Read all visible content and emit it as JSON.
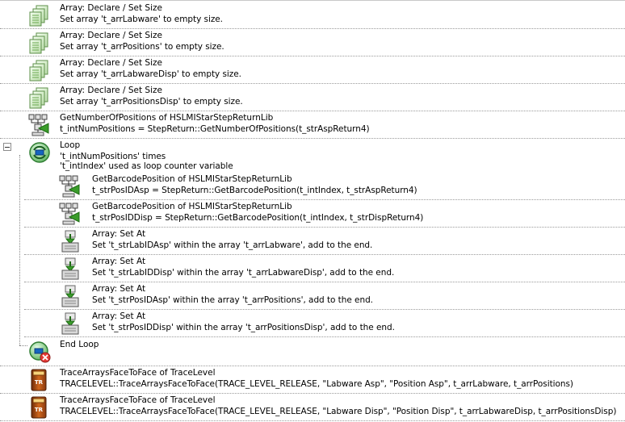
{
  "steps": [
    {
      "title": "Array: Declare / Set Size",
      "detail": "Set array 't_arrLabware' to empty size.",
      "icon": "array-declare-icon"
    },
    {
      "title": "Array: Declare / Set Size",
      "detail": "Set array 't_arrPositions' to empty size.",
      "icon": "array-declare-icon"
    },
    {
      "title": "Array: Declare / Set Size",
      "detail": "Set array 't_arrLabwareDisp' to empty size.",
      "icon": "array-declare-icon"
    },
    {
      "title": "Array: Declare / Set Size",
      "detail": "Set array 't_arrPositionsDisp' to empty size.",
      "icon": "array-declare-icon"
    },
    {
      "title": "GetNumberOfPositions of HSLMIStarStepReturnLib",
      "detail": "t_intNumPositions = StepReturn::GetNumberOfPositions(t_strAspReturn4)",
      "icon": "library-function-icon"
    },
    {
      "title": "Loop",
      "detail": "'t_intNumPositions' times",
      "detail2": "'t_intIndex' used as loop counter variable",
      "icon": "loop-icon"
    },
    {
      "title": "GetBarcodePosition of HSLMIStarStepReturnLib",
      "detail": "t_strPosIDAsp = StepReturn::GetBarcodePosition(t_intIndex, t_strAspReturn4)",
      "icon": "library-function-icon"
    },
    {
      "title": "GetBarcodePosition of HSLMIStarStepReturnLib",
      "detail": "t_strPosIDDisp = StepReturn::GetBarcodePosition(t_intIndex, t_strDispReturn4)",
      "icon": "library-function-icon"
    },
    {
      "title": "Array: Set At",
      "detail": "Set 't_strLabIDAsp' within the array 't_arrLabware', add to the end.",
      "icon": "array-set-icon"
    },
    {
      "title": "Array: Set At",
      "detail": "Set 't_strLabIDDisp' within the array 't_arrLabwareDisp', add to the end.",
      "icon": "array-set-icon"
    },
    {
      "title": "Array: Set At",
      "detail": "Set 't_strPosIDAsp' within the array 't_arrPositions', add to the end.",
      "icon": "array-set-icon"
    },
    {
      "title": "Array: Set At",
      "detail": "Set 't_strPosIDDisp' within the array 't_arrPositionsDisp', add to the end.",
      "icon": "array-set-icon"
    },
    {
      "title": "End Loop",
      "icon": "end-loop-icon"
    },
    {
      "title": "TraceArraysFaceToFace of TraceLevel",
      "detail": "TRACELEVEL::TraceArraysFaceToFace(TRACE_LEVEL_RELEASE, \"Labware Asp\", \"Position Asp\", t_arrLabware, t_arrPositions)",
      "icon": "trace-book-icon"
    },
    {
      "title": "TraceArraysFaceToFace of TraceLevel",
      "detail": "TRACELEVEL::TraceArraysFaceToFace(TRACE_LEVEL_RELEASE, \"Labware Disp\", \"Position Disp\", t_arrLabwareDisp, t_arrPositionsDisp)",
      "icon": "trace-book-icon"
    }
  ]
}
